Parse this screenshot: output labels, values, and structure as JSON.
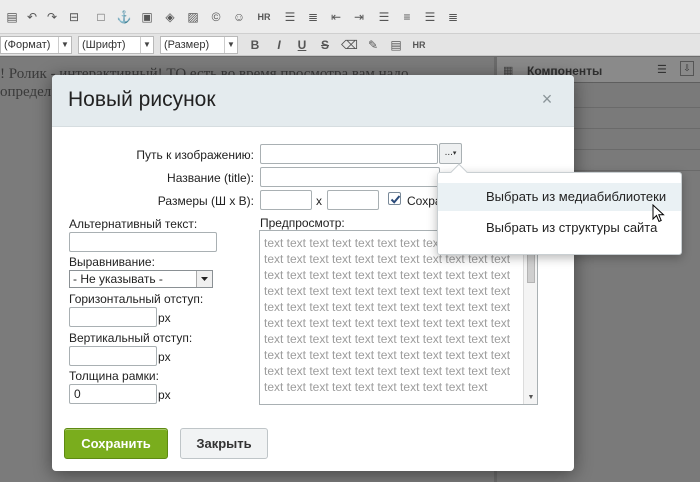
{
  "editor": {
    "toolbar_icons": [
      "undo-icon",
      "redo-icon",
      "table-icon",
      "frame-icon",
      "anchor-icon",
      "media-icon",
      "flash-icon",
      "image-icon",
      "copyright-icon",
      "smiley-icon",
      "hr-icon",
      "list-icon",
      "numbered-list-icon",
      "outdent-icon",
      "indent-icon",
      "align-left-icon",
      "align-center-icon",
      "align-right-icon",
      "justify-icon"
    ],
    "format_select": "(Формат)",
    "font_select": "(Шрифт)",
    "size_select": "(Размер)",
    "format_buttons": {
      "bold": "B",
      "italic": "I",
      "underline": "U",
      "strike": "S",
      "hr": "HR"
    },
    "content_line1": "! Ролик - интерактивный! ТО есть во время просмотра вам надо",
    "content_line2": "определ"
  },
  "side_panel": {
    "title": "Компоненты"
  },
  "dialog": {
    "title": "Новый рисунок",
    "close_symbol": "×",
    "path_label": "Путь к изображению:",
    "path_value": "",
    "browse_label": "...",
    "title_label": "Название (title):",
    "title_value": "",
    "size_label": "Размеры (Ш х В):",
    "width_value": "",
    "size_separator": "x",
    "height_value": "",
    "keep_ratio_checked": true,
    "keep_ratio_label": "Сохра",
    "alt_label": "Альтернативный текст:",
    "alt_value": "",
    "align_label": "Выравнивание:",
    "align_value": "- Не указывать -",
    "hspace_label": "Горизонтальный отступ:",
    "hspace_value": "",
    "hspace_unit": "px",
    "vspace_label": "Вертикальный отступ:",
    "vspace_value": "",
    "vspace_unit": "px",
    "border_label": "Толщина рамки:",
    "border_value": "0",
    "border_unit": "px",
    "preview_label": "Предпросмотр:",
    "preview_text": "text text text text text text text text text text text text text text text text text text text text text text text text text text text text text text text text text text text text text text text text text text text text text text text text text text text text text text text text text text text text text text text text text text text text text text text text text text text text text text text text text text text text text text text text text text text text text text text text text text text text text text text text text text text text text",
    "save_button": "Сохранить",
    "close_button": "Закрыть"
  },
  "popup_menu": {
    "items": [
      {
        "label": "Выбрать из медиабиблиотеки",
        "hovered": true
      },
      {
        "label": "Выбрать из структуры сайта",
        "hovered": false
      }
    ]
  },
  "colors": {
    "save_button": "#7aad1d",
    "dialog_header": "#e4ebee",
    "overlay": "#6b6b6b"
  }
}
